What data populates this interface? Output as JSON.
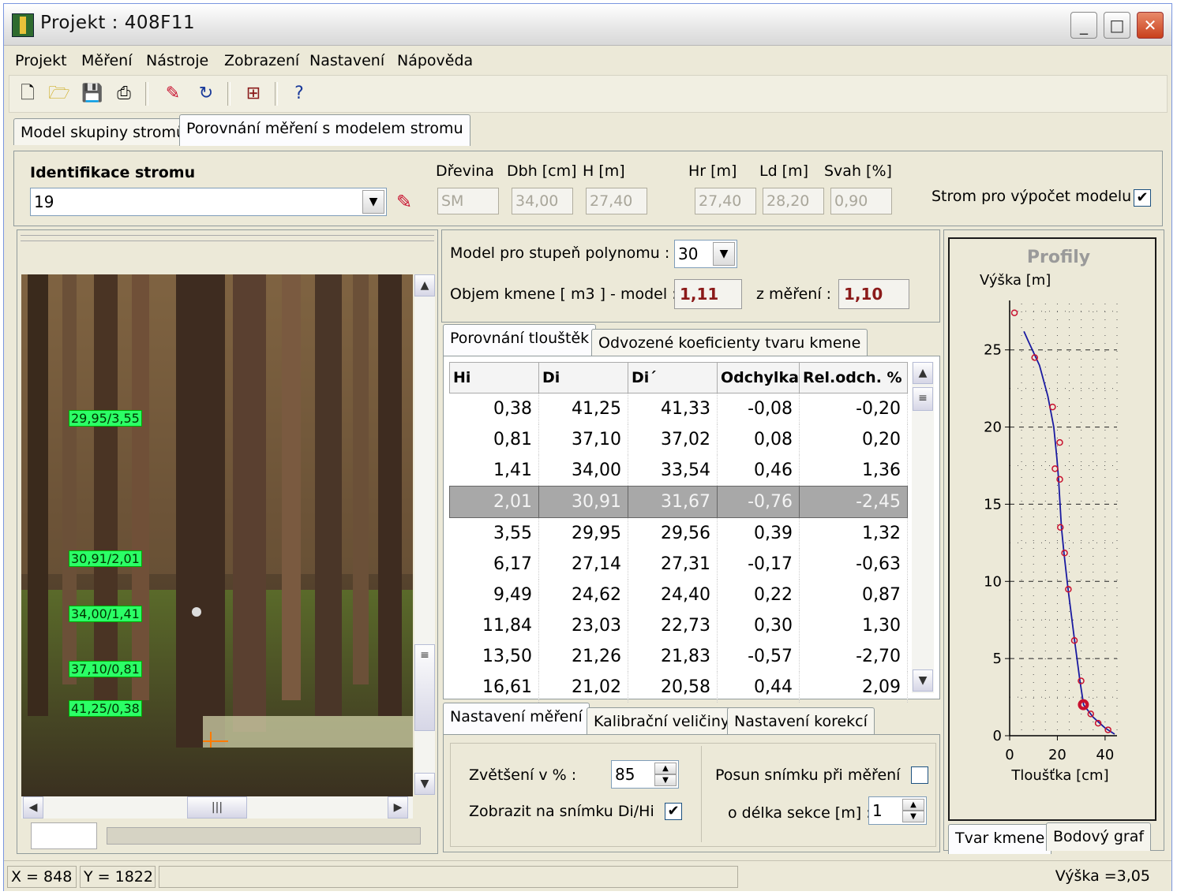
{
  "window": {
    "title": "Projekt : 408F11",
    "minimize": "_",
    "maximize": "□",
    "close": "✕"
  },
  "menu": [
    "Projekt",
    "Měření",
    "Nástroje",
    "Zobrazení",
    "Nastavení",
    "Nápověda"
  ],
  "toolbar": {
    "icons": [
      "new-icon",
      "open-icon",
      "save-icon",
      "print-icon",
      "measure-icon",
      "refresh-icon",
      "tree-icon",
      "help-icon"
    ]
  },
  "main_tabs": [
    "Model skupiny stromů",
    "Porovnání měření s modelem stromu"
  ],
  "ident": {
    "label": "Identifikace stromu",
    "value": "19",
    "drevina_label": "Dřevina",
    "drevina": "SM",
    "dbh_label": "Dbh [cm]",
    "dbh": "34,00",
    "h_label": "H [m]",
    "h": "27,40",
    "hr_label": "Hr [m]",
    "hr": "27,40",
    "ld_label": "Ld [m]",
    "ld": "28,20",
    "svah_label": "Svah [%]",
    "svah": "0,90",
    "model_tree_label": "Strom pro výpočet modelu",
    "model_tree_checked": "✔"
  },
  "photo": {
    "labels": [
      "29,95/3,55",
      "30,91/2,01",
      "34,00/1,41",
      "37,10/0,81",
      "41,25/0,38"
    ]
  },
  "model": {
    "poly_label": "Model pro stupeň polynomu  :",
    "poly_value": "30",
    "volume_label": "Objem kmene [ m3 ]  - model  :",
    "volume_model": "1,11",
    "measured_label": "z měření :",
    "volume_measured": "1,10"
  },
  "sub_tabs": [
    "Porovnání tlouštěk",
    "Odvozené koeficienty tvaru kmene"
  ],
  "table": {
    "headers": [
      "Hi",
      "Di",
      "Di´",
      "Odchylka",
      "Rel.odch. %"
    ],
    "rows": [
      [
        "0,38",
        "41,25",
        "41,33",
        "-0,08",
        "-0,20"
      ],
      [
        "0,81",
        "37,10",
        "37,02",
        "0,08",
        "0,20"
      ],
      [
        "1,41",
        "34,00",
        "33,54",
        "0,46",
        "1,36"
      ],
      [
        "2,01",
        "30,91",
        "31,67",
        "-0,76",
        "-2,45"
      ],
      [
        "3,55",
        "29,95",
        "29,56",
        "0,39",
        "1,32"
      ],
      [
        "6,17",
        "27,14",
        "27,31",
        "-0,17",
        "-0,63"
      ],
      [
        "9,49",
        "24,62",
        "24,40",
        "0,22",
        "0,87"
      ],
      [
        "11,84",
        "23,03",
        "22,73",
        "0,30",
        "1,30"
      ],
      [
        "13,50",
        "21,26",
        "21,83",
        "-0,57",
        "-2,70"
      ],
      [
        "16,61",
        "21,02",
        "20,58",
        "0,44",
        "2,09"
      ]
    ],
    "selected_row": 3
  },
  "settings_tabs": [
    "Nastavení měření",
    "Kalibrační veličiny",
    "Nastavení korekcí"
  ],
  "settings": {
    "zoom_label": "Zvětšení v % :",
    "zoom_value": "85",
    "show_label": "Zobrazit na snímku Di/Hi",
    "show_checked": "✔",
    "shift_label": "Posun snímku při měření",
    "shift_checked": "",
    "section_label": "o délka sekce [m] :",
    "section_value": "1"
  },
  "profile_chart_tabs": [
    "Tvar kmene",
    "Bodový graf"
  ],
  "chart_data": {
    "type": "line",
    "title": "Profily",
    "ylabel": "Výška [m]",
    "xlabel": "Tloušťka [cm]",
    "xlim": [
      0,
      45
    ],
    "ylim": [
      0,
      28
    ],
    "xticks": [
      "0",
      "20",
      "40"
    ],
    "yticks": [
      "0",
      "5",
      "10",
      "15",
      "20",
      "25"
    ],
    "points": [
      [
        41.25,
        0.38
      ],
      [
        37.1,
        0.81
      ],
      [
        34.0,
        1.41
      ],
      [
        30.91,
        2.01
      ],
      [
        29.95,
        3.55
      ],
      [
        27.14,
        6.17
      ],
      [
        24.62,
        9.49
      ],
      [
        23.03,
        11.84
      ],
      [
        21.26,
        13.5
      ],
      [
        21.02,
        16.61
      ],
      [
        19.0,
        17.3
      ],
      [
        21.0,
        19.0
      ],
      [
        18.0,
        21.3
      ],
      [
        10.5,
        24.5
      ],
      [
        2.0,
        27.4
      ]
    ],
    "model_curve": [
      [
        44,
        0.1
      ],
      [
        40,
        0.5
      ],
      [
        35,
        1.2
      ],
      [
        31,
        2.0
      ],
      [
        29.5,
        3.5
      ],
      [
        27.2,
        6.2
      ],
      [
        24.5,
        9.5
      ],
      [
        22.8,
        11.8
      ],
      [
        21.7,
        13.5
      ],
      [
        20.5,
        16.6
      ],
      [
        19.8,
        18.0
      ],
      [
        18.5,
        20.0
      ],
      [
        16.0,
        22.0
      ],
      [
        12.5,
        24.0
      ],
      [
        8.0,
        25.5
      ],
      [
        6.0,
        26.2
      ]
    ],
    "highlight_point": [
      30.91,
      2.01
    ],
    "point_color": "#c8102e",
    "curve_color": "#1a1aa0",
    "grid": true
  },
  "status": {
    "x": "X = 848",
    "y": "Y = 1822",
    "height": "Výška =3,05"
  }
}
